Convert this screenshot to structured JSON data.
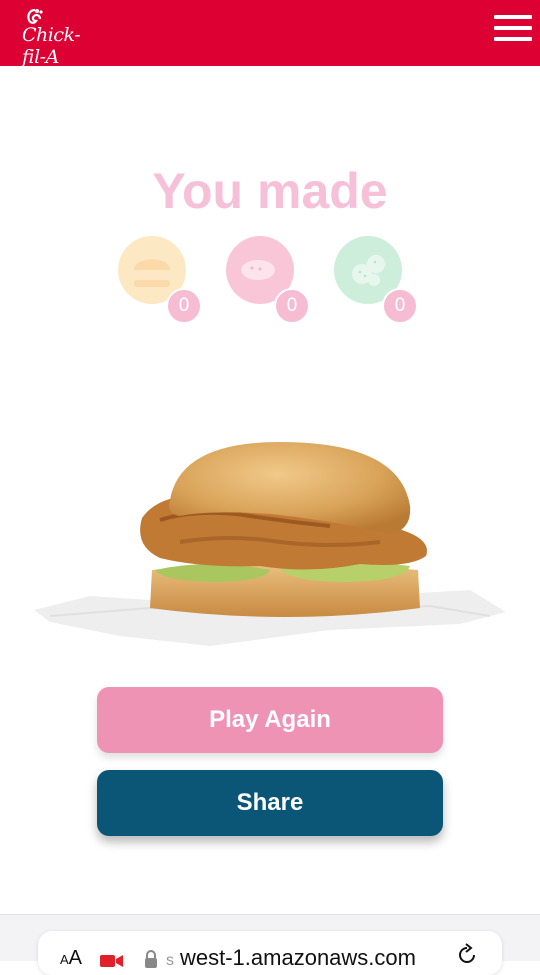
{
  "header": {
    "logo_text": "Chick-fil-A",
    "menu_icon": "hamburger-menu-icon",
    "brand_color": "#dd0033"
  },
  "results": {
    "heading": "You made",
    "items": [
      {
        "icon": "burger-icon",
        "count": "0",
        "color": "#fde8c4"
      },
      {
        "icon": "nugget-icon",
        "count": "0",
        "color": "#f9c6d8"
      },
      {
        "icon": "waffle-fries-icon",
        "count": "0",
        "color": "#cdeedb"
      }
    ]
  },
  "hero": {
    "image": "chicken-sandwich-image"
  },
  "buttons": {
    "play_again": "Play Again",
    "share": "Share"
  },
  "browser": {
    "text_size_label_small": "A",
    "text_size_label": "A",
    "url_prefix": "s",
    "url": "west-1.amazonaws.com"
  }
}
